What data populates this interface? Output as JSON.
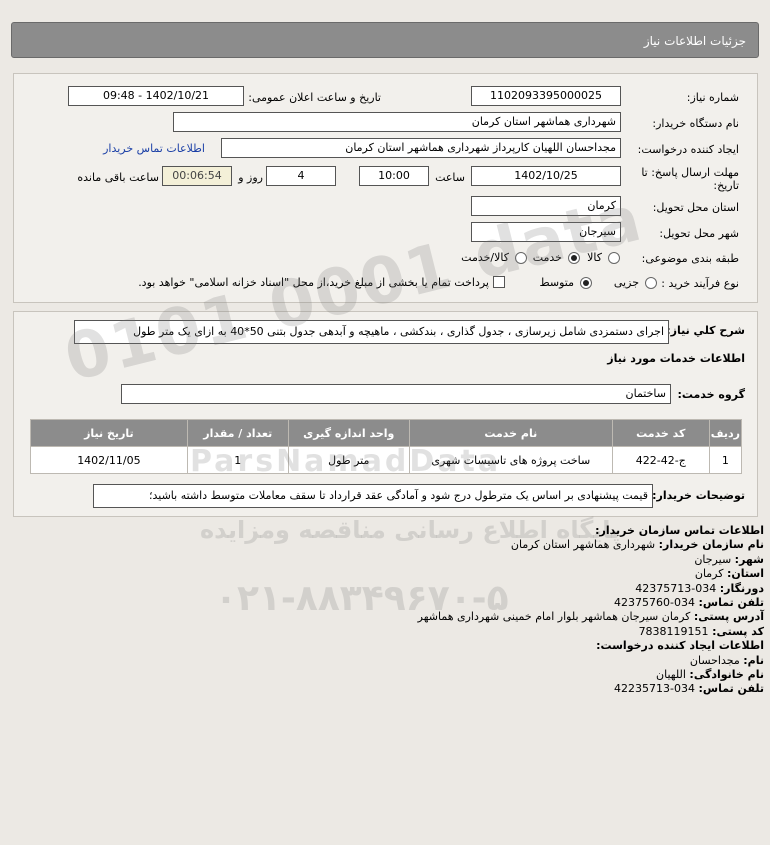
{
  "header": {
    "title": "جزئیات اطلاعات نیاز"
  },
  "need": {
    "need_number_label": "شماره نیاز:",
    "need_number": "1102093395000025",
    "announce_label": "تاریخ و ساعت اعلان عمومی:",
    "announce_value": "1402/10/21 - 09:48",
    "buyer_org_label": "نام دستگاه خریدار:",
    "buyer_org": "شهرداری هماشهر استان کرمان",
    "creator_label": "ایجاد کننده درخواست:",
    "creator": "مجداحسان اللهیان کارپرداز  شهرداری هماشهر استان کرمان",
    "contact_link": "اطلاعات تماس خریدار",
    "deadline_label": "مهلت ارسال پاسخ: تا تاریخ:",
    "deadline_date": "1402/10/25",
    "time_label": "ساعت",
    "deadline_time": "10:00",
    "days_value": "4",
    "days_label": "روز و",
    "remaining_time": "00:06:54",
    "remaining_label": "ساعت باقی مانده",
    "province_label": "استان محل تحویل:",
    "province": "کرمان",
    "city_label": "شهر محل تحویل:",
    "city": "سیرجان",
    "category_label": "طبقه بندی موضوعی:",
    "category_options": [
      "کالا",
      "خدمت",
      "کالا/خدمت"
    ],
    "category_selected": "خدمت",
    "process_label": "نوع فرآیند خرید :",
    "process_options": [
      "جزیی",
      "متوسط"
    ],
    "process_selected": "متوسط",
    "payment_text": "پرداخت تمام یا بخشی از مبلغ خرید،از محل \"اسناد خزانه اسلامی\" خواهد بود."
  },
  "description": {
    "label": "شرح كلي نياز:",
    "text": "اجرای دستمزدی شامل زیرسازی ، جدول گذاری ، بندکشی ، ماهیچه و آبدهی جدول بتنی 50*40 به ازای یک متر طول",
    "services_heading": "اطلاعات خدمات مورد نیاز",
    "service_group_label": "گروه خدمت:",
    "service_group": "ساختمان"
  },
  "table": {
    "headers": [
      "ردیف",
      "کد خدمت",
      "نام خدمت",
      "واحد اندازه گیری",
      "تعداد / مقدار",
      "تاریخ نیاز"
    ],
    "rows": [
      [
        "1",
        "ج-42-422",
        "ساخت پروژه های تاسیسات شهری",
        "متر طول",
        "1",
        "1402/11/05"
      ]
    ]
  },
  "buyer_notes": {
    "label": "توضیحات خریدار:",
    "text": "قیمت پیشنهادی بر اساس یک مترطول درج شود و آمادگی عقد قرارداد تا سقف معاملات متوسط داشته باشید؛"
  },
  "contact": {
    "heading": "اطلاعات تماس سازمان خریدار:",
    "org_label": "نام سازمان خریدار:",
    "org": "شهرداری هماشهر استان کرمان",
    "city_label": "شهر:",
    "city": "سیرجان",
    "province_label": "استان:",
    "province": "کرمان",
    "fax_label": "دورنگار:",
    "fax": "034-42375713",
    "phone_label": "تلفن تماس:",
    "phone": "034-42375760",
    "address_label": "آدرس پستی:",
    "address": "کرمان سیرجان هماشهر بلوار امام خمینی شهرداری هماشهر",
    "postal_label": "کد پستی:",
    "postal": "7838119151",
    "creator_heading": "اطلاعات ایجاد کننده درخواست:",
    "name_label": "نام:",
    "name": "مجداحسان",
    "family_label": "نام خانوادگی:",
    "family": "اللهیان",
    "creator_phone_label": "تلفن تماس:",
    "creator_phone": "034-42235713"
  }
}
